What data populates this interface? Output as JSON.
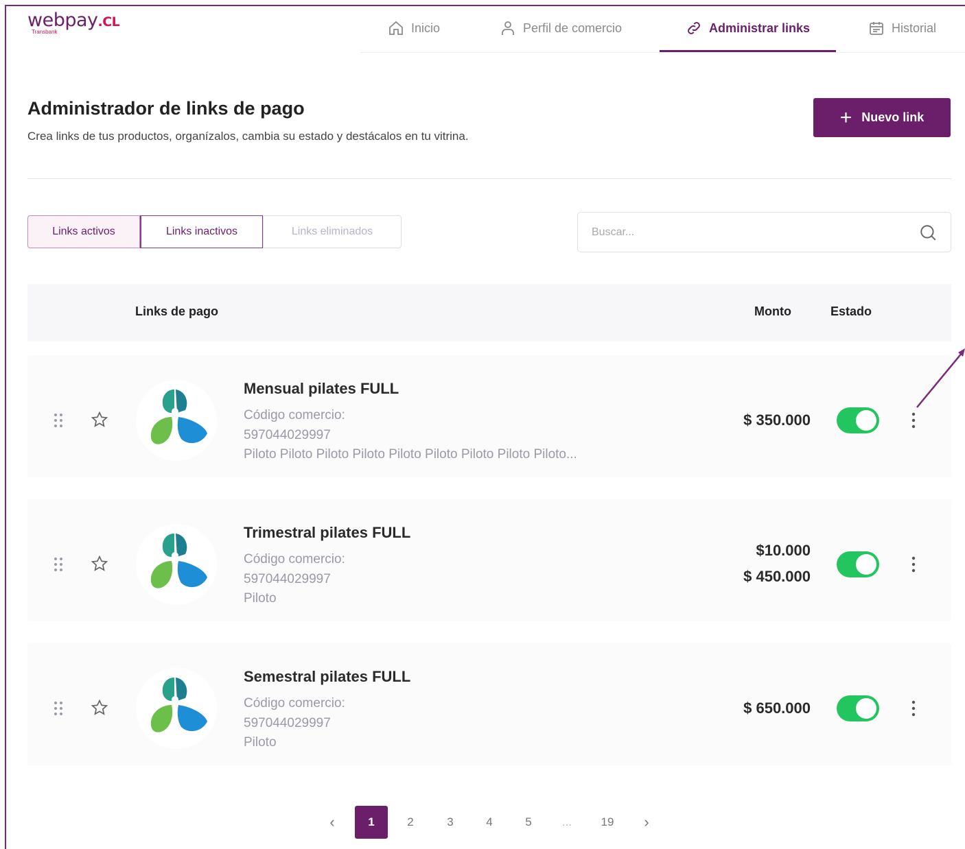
{
  "brand": {
    "name": "webpay",
    "suffix": ".CL",
    "sub": "Transbank"
  },
  "nav": {
    "items": [
      {
        "label": "Inicio",
        "icon": "home-icon"
      },
      {
        "label": "Perfil de comercio",
        "icon": "user-icon"
      },
      {
        "label": "Administrar links",
        "icon": "link-icon",
        "active": true
      },
      {
        "label": "Historial",
        "icon": "calendar-icon"
      }
    ]
  },
  "page": {
    "title": "Administrador de links de pago",
    "subtitle": "Crea links de tus productos, organízalos, cambia su estado y destácalos en tu vitrina.",
    "new_button": "Nuevo link"
  },
  "tabs": [
    "Links activos",
    "Links inactivos",
    "Links eliminados"
  ],
  "search": {
    "placeholder": "Buscar..."
  },
  "table": {
    "headers": {
      "links": "Links de pago",
      "amount": "Monto",
      "status": "Estado"
    },
    "rows": [
      {
        "name": "Mensual pilates FULL",
        "code_label": "Código comercio:",
        "code": "597044029997",
        "description": "Piloto Piloto Piloto Piloto Piloto Piloto Piloto Piloto Piloto...",
        "amounts": [
          "$ 350.000"
        ],
        "active": true
      },
      {
        "name": "Trimestral  pilates FULL",
        "code_label": "Código comercio:",
        "code": "597044029997",
        "description": "Piloto",
        "amounts": [
          "$10.000",
          "$ 450.000"
        ],
        "active": true
      },
      {
        "name": "Semestral pilates FULL",
        "code_label": "Código comercio:",
        "code": "597044029997",
        "description": "Piloto",
        "amounts": [
          "$ 650.000"
        ],
        "active": true
      }
    ]
  },
  "pagination": {
    "prev": "‹",
    "pages": [
      "1",
      "2",
      "3",
      "4",
      "5",
      "...",
      "19"
    ],
    "current": "1",
    "next": "›"
  },
  "colors": {
    "brand": "#6b1f6b",
    "toggle_on": "#22c55e",
    "accent": "#d4145a"
  }
}
